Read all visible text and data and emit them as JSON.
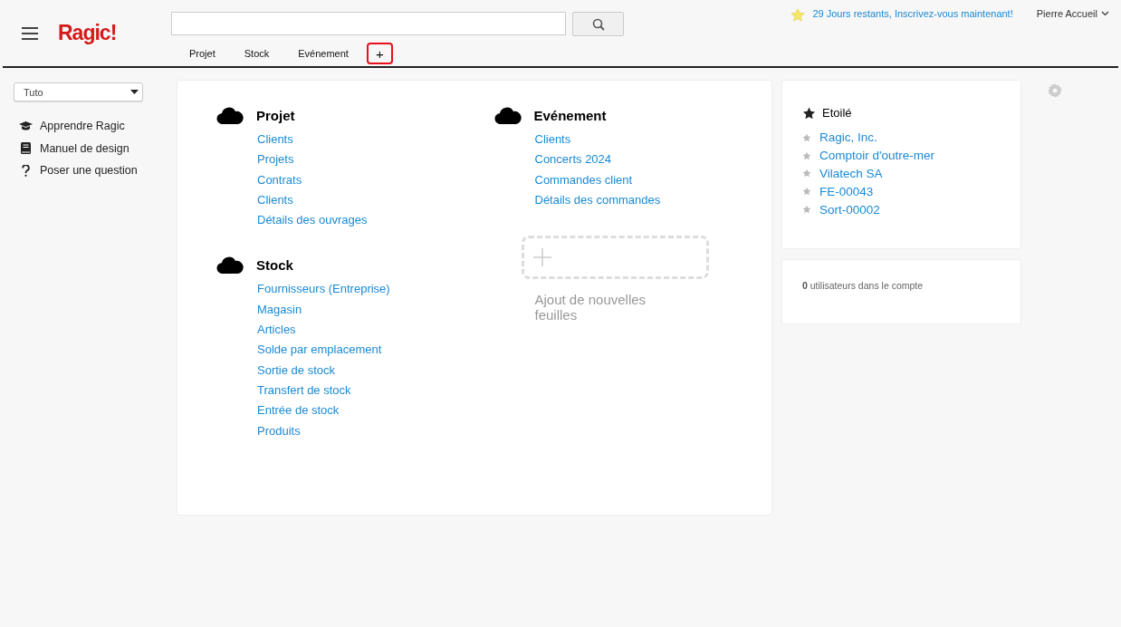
{
  "header": {
    "logo": "Ragic!",
    "trial_notice": "29 Jours restants, Inscrivez-vous maintenant!",
    "user": "Pierre Accueil"
  },
  "tabs": [
    {
      "label": "Projet",
      "highlighted": false
    },
    {
      "label": "Stock",
      "highlighted": false
    },
    {
      "label": "Evénement",
      "highlighted": false
    },
    {
      "label": "+",
      "highlighted": true
    }
  ],
  "sidebar": {
    "dropdown": "Tuto",
    "items": [
      {
        "kind": "cap",
        "label": "Apprendre Ragic"
      },
      {
        "kind": "book",
        "label": "Manuel de design"
      },
      {
        "kind": "question",
        "label": "Poser une question"
      }
    ]
  },
  "tab_columns": [
    [
      {
        "title": "Projet",
        "sheets": [
          "Clients",
          "Projets",
          "Contrats",
          "Clients",
          "Détails des ouvrages"
        ]
      },
      {
        "title": "Stock",
        "sheets": [
          "Fournisseurs (Entreprise)",
          "Magasin",
          "Articles",
          "Solde par emplacement",
          "Sortie de stock",
          "Transfert de stock",
          "Entrée de stock",
          "Produits"
        ]
      }
    ],
    [
      {
        "title": "Evénement",
        "sheets": [
          "Clients",
          "Concerts 2024",
          "Commandes client",
          "Détails des commandes"
        ]
      }
    ]
  ],
  "add_sheets": "Ajout de nouvelles feuilles",
  "starred": {
    "title": "Etoilé",
    "items": [
      "Ragic, Inc.",
      "Comptoir d'outre-mer",
      "Vilatech SA",
      "FE-00043",
      "Sort-00002"
    ]
  },
  "users": {
    "count": "0",
    "text": "utilisateurs dans le compte"
  }
}
